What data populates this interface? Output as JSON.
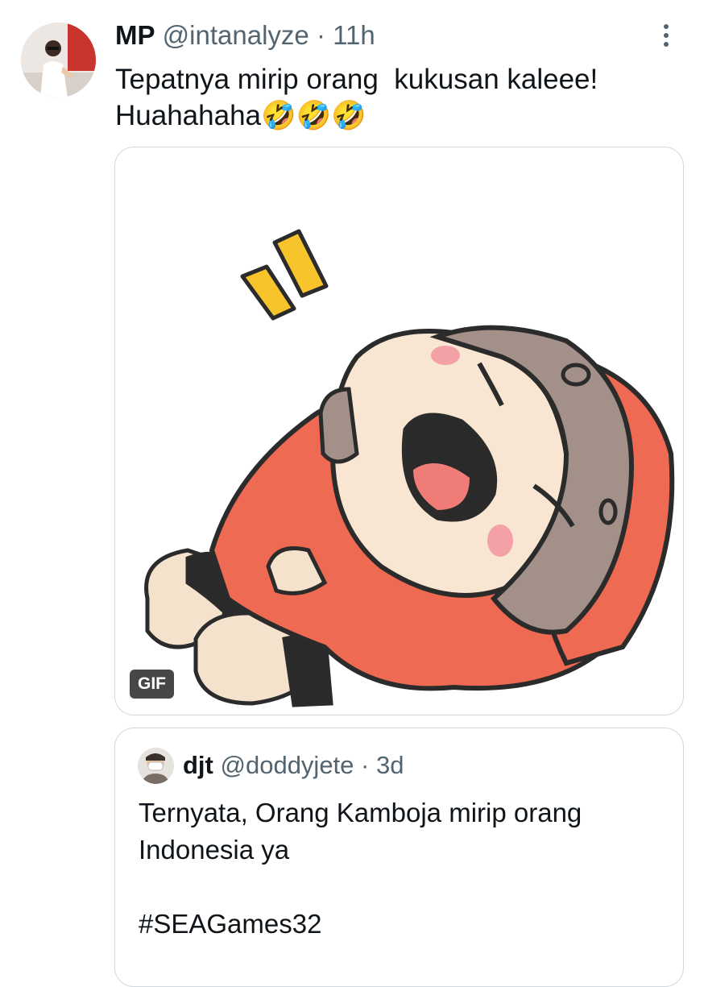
{
  "tweet": {
    "display_name": "MP",
    "handle": "@intanalyze",
    "separator": "·",
    "time": "11h",
    "text_line1": "Tepatnya mirip orang  kukusan kaleee!",
    "text_line2": "Huahahaha🤣🤣🤣",
    "more_icon": "more-vertical-icon"
  },
  "media": {
    "type": "gif",
    "badge": "GIF",
    "description_icon": "laughing-cartoon-girl-gif"
  },
  "quoted_tweet": {
    "display_name": "djt",
    "handle": "@doddyjete",
    "separator": "·",
    "time": "3d",
    "text_line1": "Ternyata, Orang Kamboja mirip orang",
    "text_line2": "Indonesia ya",
    "hashtag": "#SEAGames32"
  },
  "colors": {
    "primary_text": "#0f1419",
    "secondary_text": "#536471",
    "border": "#cfd9de",
    "hoodie": "#ef6a52"
  }
}
